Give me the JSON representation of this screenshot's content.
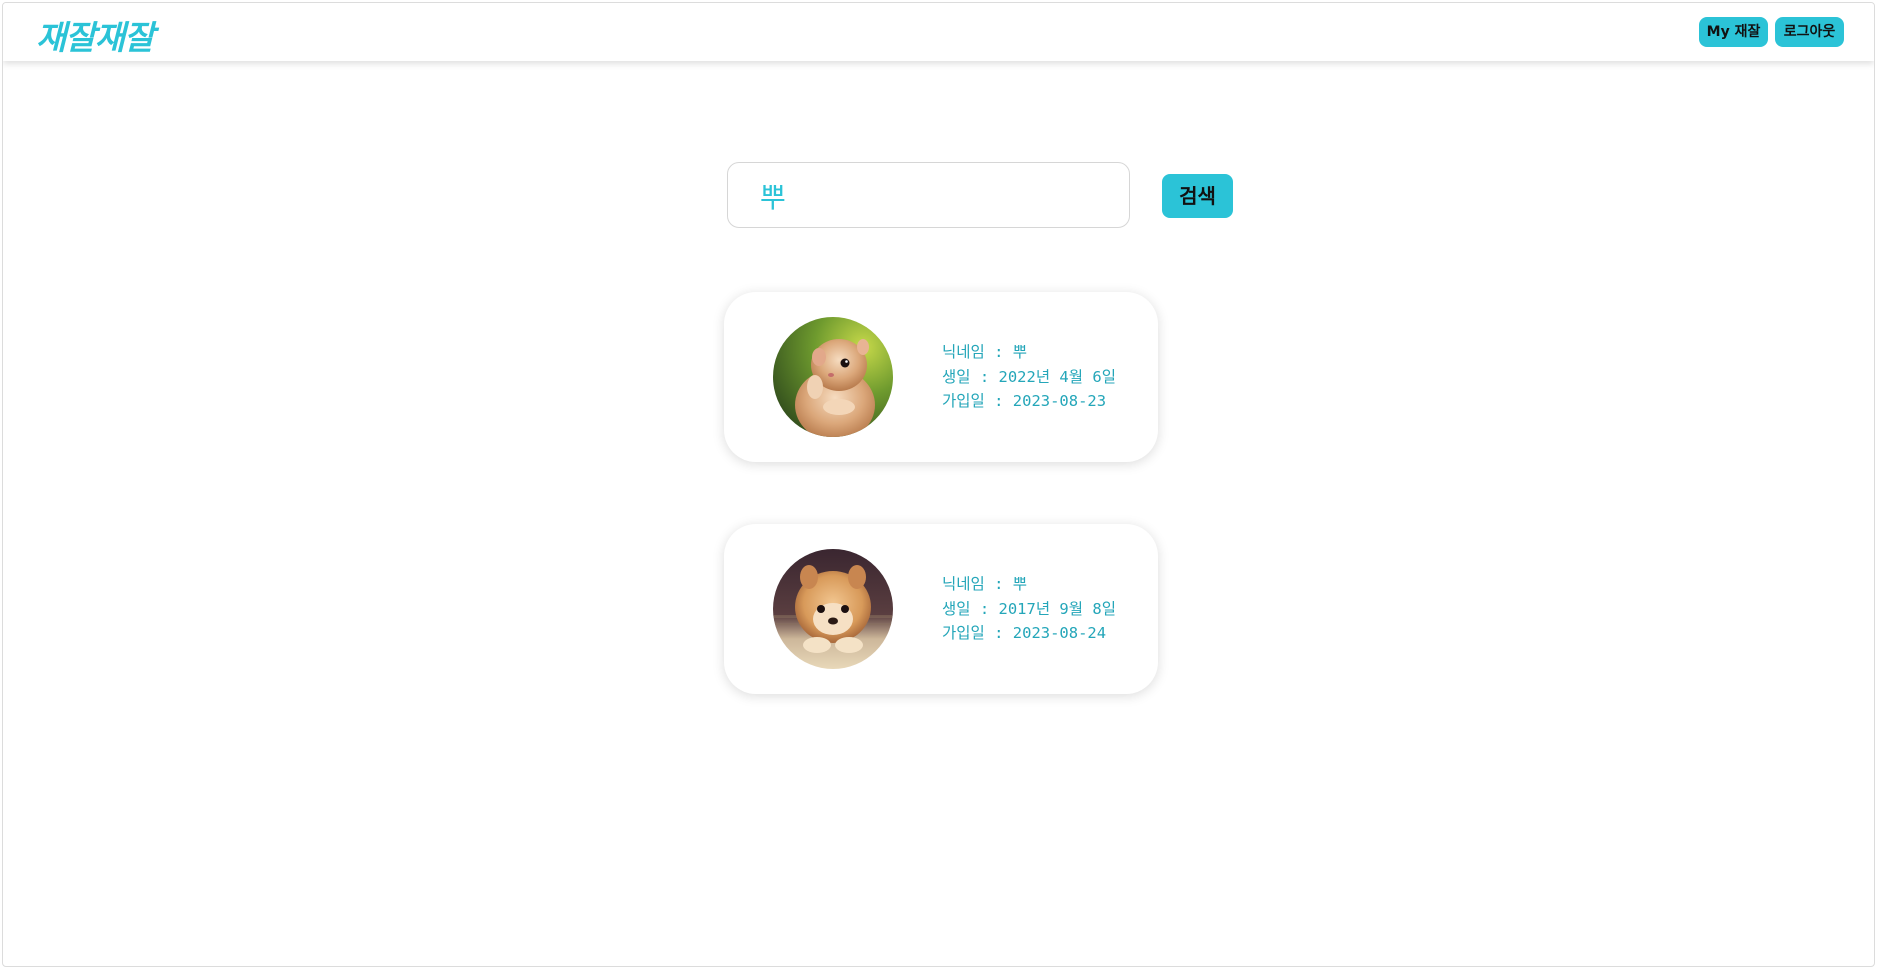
{
  "header": {
    "logo": "재잘재잘",
    "my_button": "My 재잘",
    "logout_button": "로그아웃"
  },
  "search": {
    "value": "뿌",
    "button_label": "검색"
  },
  "results": [
    {
      "nickname_line": "닉네임 : 뿌",
      "birthday_line": "생일 : 2022년 4월 6일",
      "joined_line": "가입일 : 2023-08-23",
      "avatar_icon": "hamster-photo"
    },
    {
      "nickname_line": "닉네임 : 뿌",
      "birthday_line": "생일 : 2017년 9월 8일",
      "joined_line": "가입일 : 2023-08-24",
      "avatar_icon": "pomeranian-photo"
    }
  ],
  "colors": {
    "accent": "#2bc3d7",
    "text_accent": "#24a6b9"
  }
}
